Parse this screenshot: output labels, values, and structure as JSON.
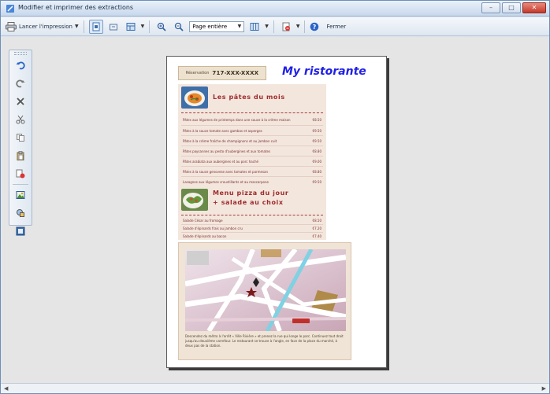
{
  "window": {
    "title": "Modifier et imprimer des extractions",
    "buttons": {
      "minimize": "–",
      "maximize": "□",
      "close": "✕"
    }
  },
  "toolbar": {
    "print_label": "Lancer l'impression",
    "zoom_select": "Page entière",
    "close_label": "Fermer",
    "icons": [
      "printer-icon",
      "fit-page-icon",
      "rotate-icon",
      "layout-icon",
      "zoom-in-icon",
      "zoom-out-icon",
      "columns-icon",
      "delete-page-icon",
      "help-icon"
    ]
  },
  "palette": {
    "icons": [
      "undo-icon",
      "redo-icon",
      "close-icon",
      "cut-icon",
      "copy-icon",
      "paste-icon",
      "delete-icon",
      "image-icon",
      "clipart-icon",
      "frame-icon"
    ]
  },
  "page": {
    "phone_label": "Réservation",
    "phone_number": "717-XXX-XXXX",
    "restaurant_title": "My ristorante",
    "sections": [
      {
        "heading": "Les pâtes du mois",
        "items": [
          {
            "name": "Pâtes aux légumes de printemps dans une sauce à la crème maison",
            "price": "€8.50"
          },
          {
            "name": "Pâtes à la sauce tomate avec gambas et asperges",
            "price": "€9.50"
          },
          {
            "name": "Pâtes à la crème fraîche de champignons et au jambon cuit",
            "price": "€9.50"
          },
          {
            "name": "Pâtes paysannes au pesto d'aubergines et aux tomates",
            "price": "€8.80"
          },
          {
            "name": "Pâtes arabiata aux aubergines et au porc haché",
            "price": "€9.00"
          },
          {
            "name": "Pâtes à la sauce genovese avec tomates et parmesan",
            "price": "€8.80"
          },
          {
            "name": "Lasagnes aux légumes croustillants et au mascarpone",
            "price": "€9.50"
          }
        ]
      },
      {
        "heading_line1": "Menu pizza du jour",
        "heading_line2": "+ salade au choix",
        "items": [
          {
            "name": "Salade César au fromage",
            "price": "€8.50"
          },
          {
            "name": "Salade d'épinards frais au jambon cru",
            "price": "€7.20"
          },
          {
            "name": "Salade d'épinards au bacon",
            "price": "€7.40"
          }
        ]
      }
    ],
    "map_caption": "Descendez du métro à l'arrêt « Ville Rivière » et prenez la rue qui longe le parc. Continuez tout droit jusqu'au deuxième carrefour. Le restaurant se trouve à l'angle, en face de la place du marché, à deux pas de la station."
  },
  "colors": {
    "accent_blue": "#2020e8",
    "menu_red": "#9e2b2b",
    "card_bg": "#f3e6dd"
  }
}
